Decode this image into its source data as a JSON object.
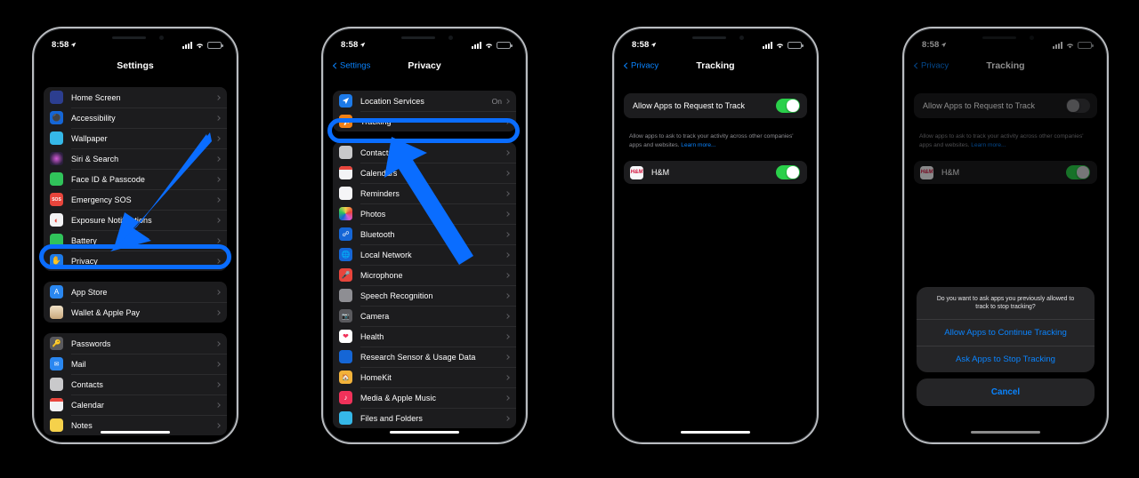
{
  "status_bar": {
    "time": "8:58",
    "location_icon": "location-arrow-icon",
    "cellular_icon": "cellular-bars-icon",
    "wifi_icon": "wifi-icon",
    "battery_icon": "battery-icon"
  },
  "colors": {
    "annotation": "#0a6dff",
    "accent_blue": "#0a84ff",
    "toggle_on": "#2ad04a",
    "toggle_off": "#39393d"
  },
  "phone1": {
    "title": "Settings",
    "groups": [
      {
        "rows": [
          {
            "label": "Home Screen",
            "icon": "home-screen-icon",
            "color": "#2c3e8f"
          },
          {
            "label": "Accessibility",
            "icon": "accessibility-icon",
            "color": "#1566d6"
          },
          {
            "label": "Wallpaper",
            "icon": "wallpaper-icon",
            "color": "#35b8e8"
          },
          {
            "label": "Siri & Search",
            "icon": "siri-icon",
            "color": "#2b1f3d"
          },
          {
            "label": "Face ID & Passcode",
            "icon": "face-id-icon",
            "color": "#30c35a"
          },
          {
            "label": "Emergency SOS",
            "icon": "emergency-sos-icon",
            "color": "#e8453c"
          },
          {
            "label": "Exposure Notifications",
            "icon": "exposure-notifications-icon",
            "color": "#f2f2f4"
          },
          {
            "label": "Battery",
            "icon": "battery-settings-icon",
            "color": "#30c35a"
          },
          {
            "label": "Privacy",
            "icon": "privacy-hand-icon",
            "color": "#1d7ae8",
            "highlighted": true
          }
        ]
      },
      {
        "rows": [
          {
            "label": "App Store",
            "icon": "app-store-icon",
            "color": "#2a87f0"
          },
          {
            "label": "Wallet & Apple Pay",
            "icon": "wallet-icon",
            "color": "#22211f"
          }
        ]
      },
      {
        "rows": [
          {
            "label": "Passwords",
            "icon": "passwords-key-icon",
            "color": "#5a5a5e"
          },
          {
            "label": "Mail",
            "icon": "mail-icon",
            "color": "#2a87f0"
          },
          {
            "label": "Contacts",
            "icon": "contacts-icon",
            "color": "#c9c9cb"
          },
          {
            "label": "Calendar",
            "icon": "calendar-icon",
            "color": "#f3f3f5"
          },
          {
            "label": "Notes",
            "icon": "notes-icon",
            "color": "#f5d14b"
          }
        ]
      }
    ]
  },
  "phone2": {
    "back_label": "Settings",
    "title": "Privacy",
    "groups": [
      {
        "rows": [
          {
            "label": "Location Services",
            "value": "On",
            "icon": "location-services-icon",
            "color": "#1d7ae8"
          },
          {
            "label": "Tracking",
            "icon": "tracking-icon",
            "color": "#f08016",
            "highlighted": true
          }
        ]
      },
      {
        "rows": [
          {
            "label": "Contacts",
            "icon": "contacts-icon",
            "color": "#c9c9cb"
          },
          {
            "label": "Calendars",
            "icon": "calendars-icon",
            "color": "#f3f3f5"
          },
          {
            "label": "Reminders",
            "icon": "reminders-icon",
            "color": "#f5f5f7"
          },
          {
            "label": "Photos",
            "icon": "photos-icon",
            "color": "#ffffff"
          },
          {
            "label": "Bluetooth",
            "icon": "bluetooth-icon",
            "color": "#1566d6"
          },
          {
            "label": "Local Network",
            "icon": "local-network-icon",
            "color": "#1566d6"
          },
          {
            "label": "Microphone",
            "icon": "microphone-icon",
            "color": "#e8453c"
          },
          {
            "label": "Speech Recognition",
            "icon": "speech-recognition-icon",
            "color": "#8e8e93"
          },
          {
            "label": "Camera",
            "icon": "camera-icon",
            "color": "#5a5a5e"
          },
          {
            "label": "Health",
            "icon": "health-icon",
            "color": "#ffffff"
          },
          {
            "label": "Research Sensor & Usage Data",
            "icon": "research-sensor-icon",
            "color": "#1566d6"
          },
          {
            "label": "HomeKit",
            "icon": "homekit-icon",
            "color": "#f2b23a"
          },
          {
            "label": "Media & Apple Music",
            "icon": "media-apple-music-icon",
            "color": "#f0325a"
          },
          {
            "label": "Files and Folders",
            "icon": "files-and-folders-icon",
            "color": "#35b8e8"
          }
        ]
      }
    ]
  },
  "phone3": {
    "back_label": "Privacy",
    "title": "Tracking",
    "allow_label": "Allow Apps to Request to Track",
    "allow_enabled": true,
    "footnote_text": "Allow apps to ask to track your activity across other companies' apps and websites. ",
    "footnote_link": "Learn more...",
    "apps": [
      {
        "label": "H&M",
        "icon": "hm-app-icon",
        "enabled": true
      }
    ]
  },
  "phone4": {
    "back_label": "Privacy",
    "title": "Tracking",
    "allow_label": "Allow Apps to Request to Track",
    "allow_enabled": false,
    "footnote_text": "Allow apps to ask to track your activity across other companies' apps and websites. ",
    "footnote_link": "Learn more...",
    "apps": [
      {
        "label": "H&M",
        "icon": "hm-app-icon",
        "enabled": true
      }
    ],
    "alert": {
      "message": "Do you want to ask apps you previously allowed to track to stop tracking?",
      "buttons": [
        "Allow Apps to Continue Tracking",
        "Ask Apps to Stop Tracking"
      ],
      "cancel": "Cancel"
    }
  }
}
